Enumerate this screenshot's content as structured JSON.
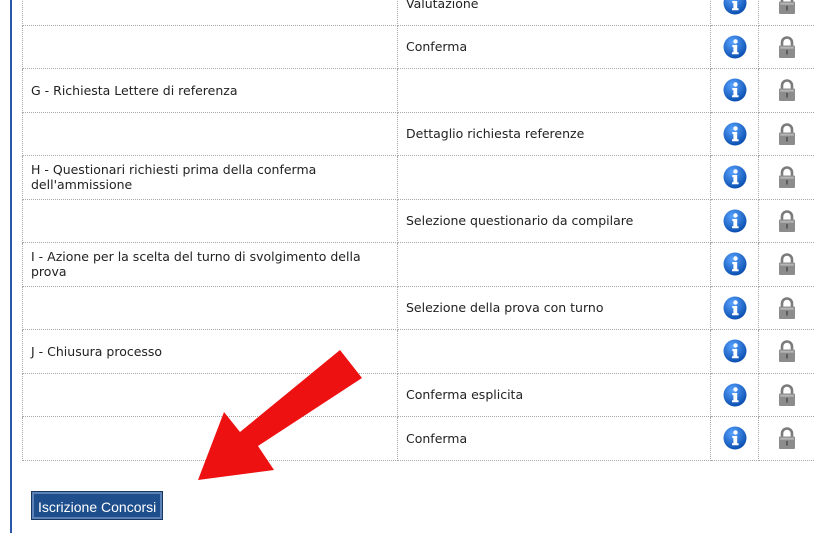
{
  "rows": [
    {
      "step": "",
      "sub": "Valutazione",
      "info_icon": "info-icon",
      "lock_icon": "lock-icon"
    },
    {
      "step": "",
      "sub": "Conferma",
      "info_icon": "info-icon",
      "lock_icon": "lock-icon"
    },
    {
      "step": "G - Richiesta Lettere di referenza",
      "sub": "",
      "info_icon": "info-icon",
      "lock_icon": "lock-icon"
    },
    {
      "step": "",
      "sub": "Dettaglio richiesta referenze",
      "info_icon": "info-icon",
      "lock_icon": "lock-icon"
    },
    {
      "step": "H - Questionari richiesti prima della conferma dell'ammissione",
      "sub": "",
      "info_icon": "info-icon",
      "lock_icon": "lock-icon"
    },
    {
      "step": "",
      "sub": "Selezione questionario da compilare",
      "info_icon": "info-icon",
      "lock_icon": "lock-icon"
    },
    {
      "step": "I - Azione per la scelta del turno di svolgimento della prova",
      "sub": "",
      "info_icon": "info-icon",
      "lock_icon": "lock-icon"
    },
    {
      "step": "",
      "sub": "Selezione della prova con turno",
      "info_icon": "info-icon",
      "lock_icon": "lock-icon"
    },
    {
      "step": "J - Chiusura processo",
      "sub": "",
      "info_icon": "info-icon",
      "lock_icon": "lock-icon"
    },
    {
      "step": "",
      "sub": "Conferma esplicita",
      "info_icon": "info-icon",
      "lock_icon": "lock-icon"
    },
    {
      "step": "",
      "sub": "Conferma",
      "info_icon": "info-icon",
      "lock_icon": "lock-icon"
    }
  ],
  "button": {
    "label": "Iscrizione Concorsi"
  },
  "annotation": {
    "icon": "red-arrow-icon",
    "color": "#ee1111"
  },
  "colors": {
    "info": "#1f6fd1",
    "lock": "#8c8c8c",
    "button_bg": "#1e4e8c",
    "rule": "#2b58a6"
  }
}
